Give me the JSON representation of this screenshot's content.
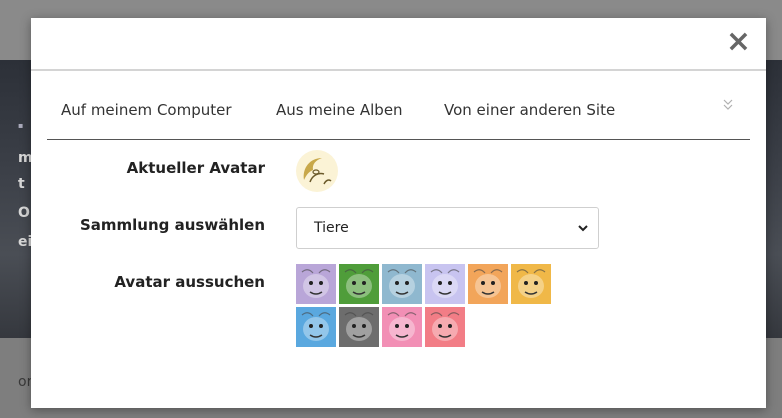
{
  "background": {
    "texts": [
      "m",
      "t",
      "O",
      "ei",
      "or"
    ]
  },
  "modal": {
    "close_label": "×",
    "tabs": [
      {
        "label": "Auf meinem Computer"
      },
      {
        "label": "Aus meine Alben"
      },
      {
        "label": "Von einer anderen Site"
      }
    ],
    "current_avatar_label": "Aktueller Avatar",
    "collection_label": "Sammlung auswählen",
    "collection_value": "Tiere",
    "choose_label": "Avatar aussuchen",
    "avatars": [
      {
        "name": "dog-avatar",
        "color": "#b9a6d8"
      },
      {
        "name": "parrot-avatar",
        "color": "#4f9d3a"
      },
      {
        "name": "bulldog-avatar",
        "color": "#8fb8cf"
      },
      {
        "name": "elephant-avatar",
        "color": "#c8c4f0"
      },
      {
        "name": "tiger-avatar",
        "color": "#f2a55a"
      },
      {
        "name": "giraffe-avatar",
        "color": "#f0b848"
      },
      {
        "name": "crocodile-avatar",
        "color": "#5aa8df"
      },
      {
        "name": "gorilla-avatar",
        "color": "#6d6d6d"
      },
      {
        "name": "pig-avatar",
        "color": "#f28fb5"
      },
      {
        "name": "rabbit-avatar",
        "color": "#f27d86"
      }
    ]
  }
}
